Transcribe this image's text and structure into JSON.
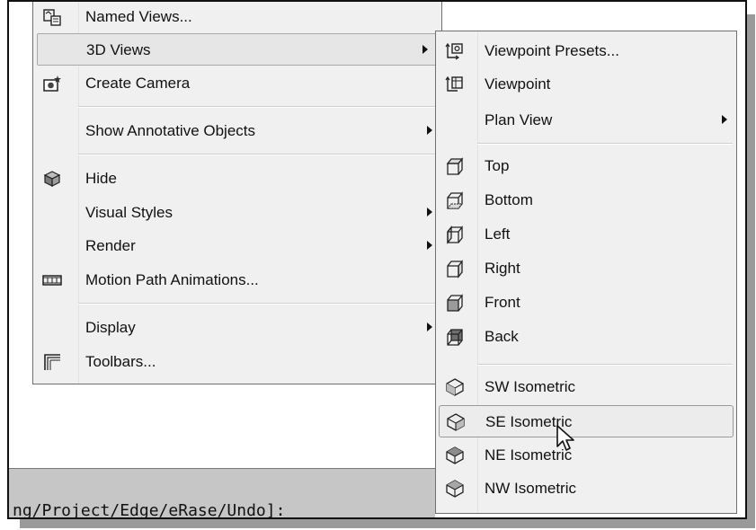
{
  "command_line": {
    "text": "ng/Project/Edge/eRase/Undo]:"
  },
  "view_menu": {
    "items": [
      {
        "label": "Named Views...",
        "icon": "named-views-icon"
      },
      {
        "label": "3D Views",
        "icon": "",
        "submenu": true,
        "highlighted": true
      },
      {
        "label": "Create Camera",
        "icon": "camera-icon"
      },
      {
        "label": "Show Annotative Objects",
        "icon": "",
        "submenu": true
      },
      {
        "label": "Hide",
        "icon": "hide-icon"
      },
      {
        "label": "Visual Styles",
        "icon": "",
        "submenu": true
      },
      {
        "label": "Render",
        "icon": "",
        "submenu": true
      },
      {
        "label": "Motion Path Animations...",
        "icon": "film-icon"
      },
      {
        "label": "Display",
        "icon": "",
        "submenu": true
      },
      {
        "label": "Toolbars...",
        "icon": "toolbars-icon"
      }
    ]
  },
  "views_submenu": {
    "items": [
      {
        "label": "Viewpoint Presets...",
        "icon": "viewpoint-presets-icon"
      },
      {
        "label": "Viewpoint",
        "icon": "viewpoint-icon"
      },
      {
        "label": "Plan View",
        "icon": "",
        "submenu": true
      },
      {
        "label": "Top",
        "icon": "cube-top-icon"
      },
      {
        "label": "Bottom",
        "icon": "cube-bottom-icon"
      },
      {
        "label": "Left",
        "icon": "cube-left-icon"
      },
      {
        "label": "Right",
        "icon": "cube-right-icon"
      },
      {
        "label": "Front",
        "icon": "cube-front-icon"
      },
      {
        "label": "Back",
        "icon": "cube-back-icon"
      },
      {
        "label": "SW Isometric",
        "icon": "isometric-sw-icon"
      },
      {
        "label": "SE Isometric",
        "icon": "isometric-se-icon",
        "highlighted": true
      },
      {
        "label": "NE Isometric",
        "icon": "isometric-ne-icon"
      },
      {
        "label": "NW Isometric",
        "icon": "isometric-nw-icon"
      }
    ]
  },
  "colors": {
    "menu_bg": "#f0f0f0",
    "highlight": "#e6e6e6",
    "command_bg": "#c6c6c6"
  }
}
